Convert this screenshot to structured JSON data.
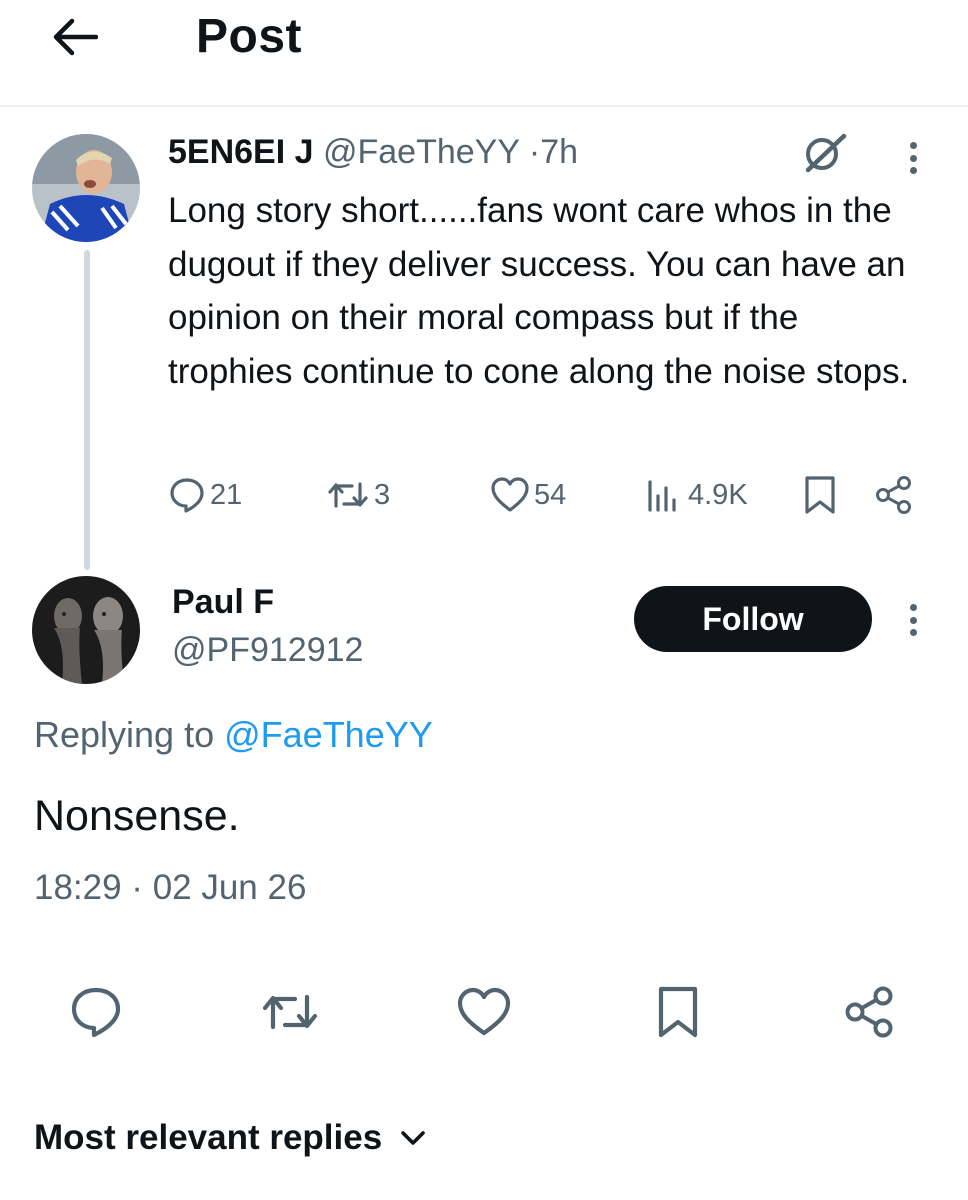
{
  "header": {
    "title": "Post"
  },
  "parent_post": {
    "display_name": "5EN6EI J",
    "handle": "@FaeTheYY",
    "dot": "·",
    "time": "7h",
    "text": "Long story short......fans wont care whos in the dugout if they deliver success. You can have an opinion on their moral compass but if the trophies continue to cone along the noise stops.",
    "stats": {
      "replies": "21",
      "reposts": "3",
      "likes": "54",
      "views": "4.9K"
    }
  },
  "reply_post": {
    "display_name": "Paul F",
    "handle": "@PF912912",
    "follow_label": "Follow",
    "replying_prefix": "Replying to ",
    "replying_handle": "@FaeTheYY",
    "text": "Nonsense.",
    "timestamp": "18:29 · 02 Jun 26"
  },
  "replies_sort": {
    "label": "Most relevant replies"
  },
  "icons": {
    "back": "arrow-left-icon",
    "grok": "grok-icon",
    "more": "more-vertical-icon",
    "reply": "reply-bubble-icon",
    "repost": "repost-icon",
    "like": "heart-icon",
    "views": "views-chart-icon",
    "bookmark": "bookmark-icon",
    "share": "share-icon",
    "chevron": "chevron-down-icon"
  },
  "colors": {
    "text_primary": "#0f1419",
    "text_secondary": "#536471",
    "link": "#1d9bf0",
    "thread_line": "#cfd9de",
    "follow_bg": "#0f1419"
  }
}
